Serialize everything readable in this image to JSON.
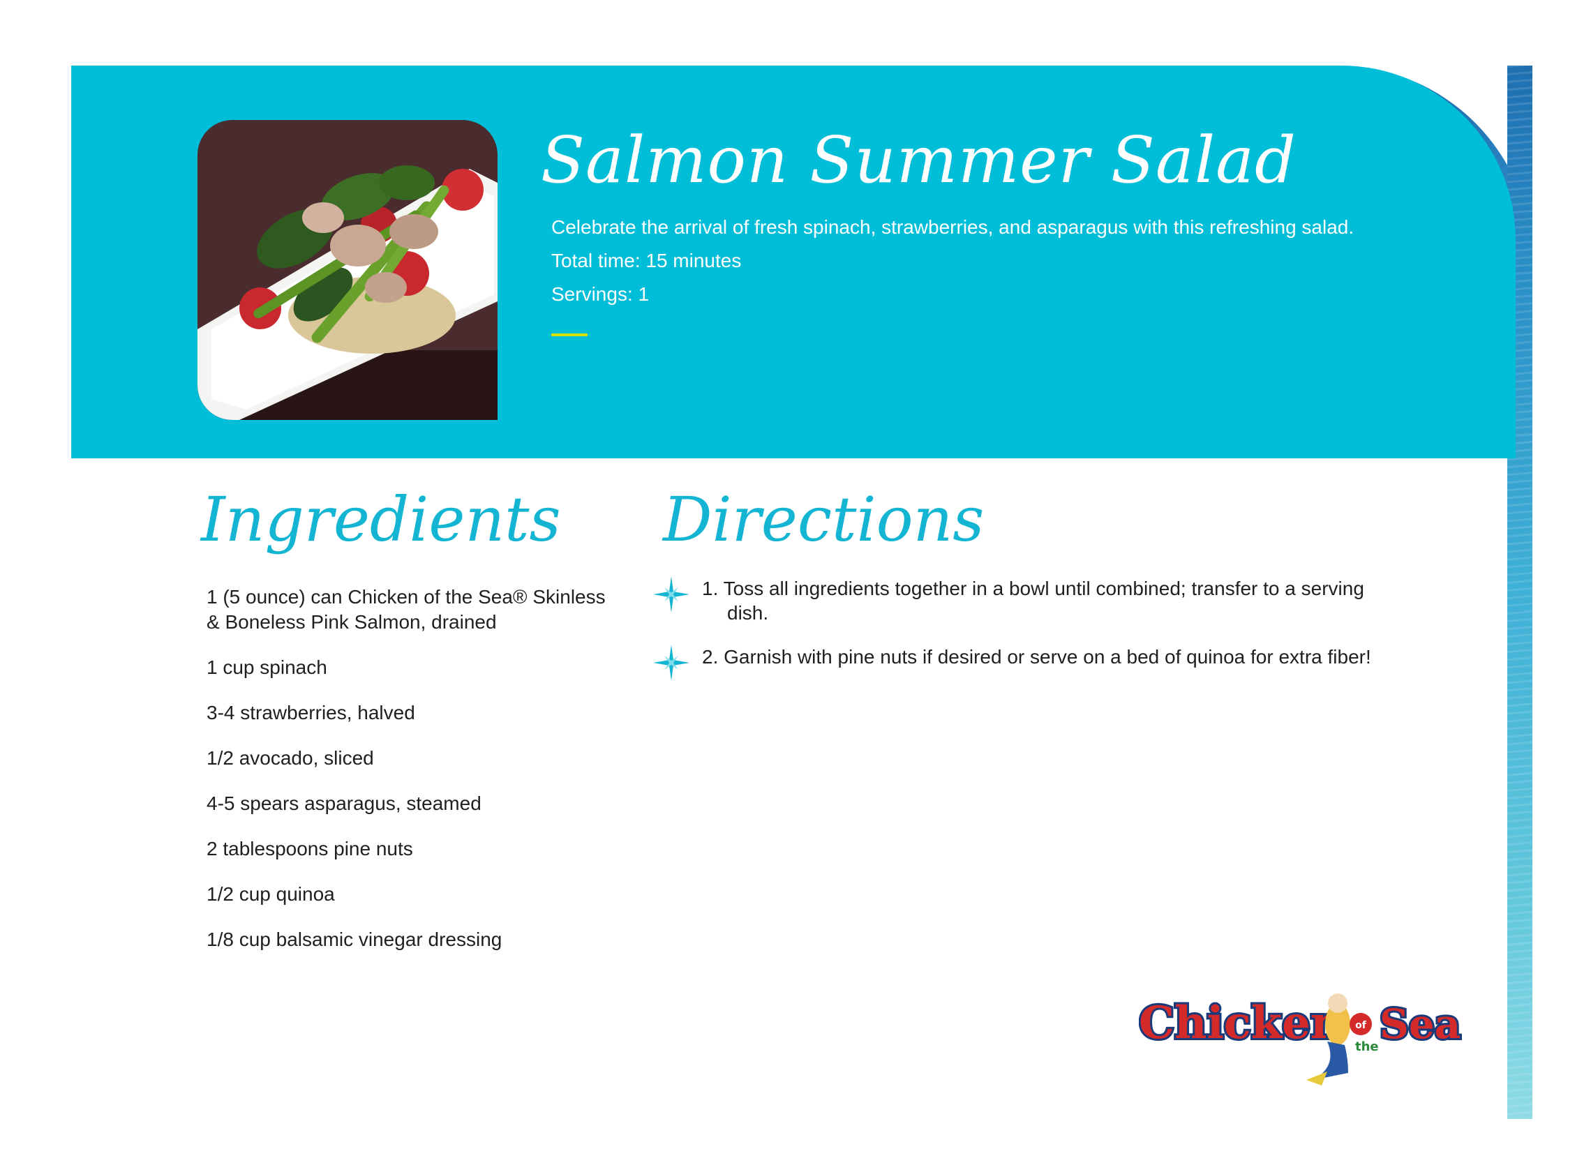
{
  "recipe": {
    "title": "Salmon Summer Salad",
    "description": "Celebrate the arrival of fresh spinach, strawberries, and asparagus with this refreshing salad.",
    "total_time": "Total time: 15 minutes",
    "servings": "Servings: 1"
  },
  "ingredients": {
    "heading": "Ingredients",
    "items": [
      "1 (5 ounce) can Chicken of the Sea® Skinless & Boneless Pink Salmon, drained",
      "1 cup spinach",
      "3-4 strawberries, halved",
      "1/2 avocado, sliced",
      "4-5 spears asparagus, steamed",
      "2 tablespoons pine nuts",
      "1/2 cup quinoa",
      "1/8 cup balsamic vinegar dressing"
    ]
  },
  "directions": {
    "heading": "Directions",
    "steps": [
      "1. Toss all ingredients together in a bowl until combined; transfer to a serving dish.",
      "2. Garnish with pine nuts if desired or serve on a bed of quinoa for extra fiber!"
    ]
  },
  "brand": {
    "logo_text": "Chicken of the Sea",
    "logo_color": "#d42a2a"
  },
  "colors": {
    "header_bg": "#00bdd8",
    "heading_text": "#13b5d3",
    "accent_bar": "#d6e300"
  },
  "icons": {
    "step_marker": "sparkle-star-icon"
  }
}
